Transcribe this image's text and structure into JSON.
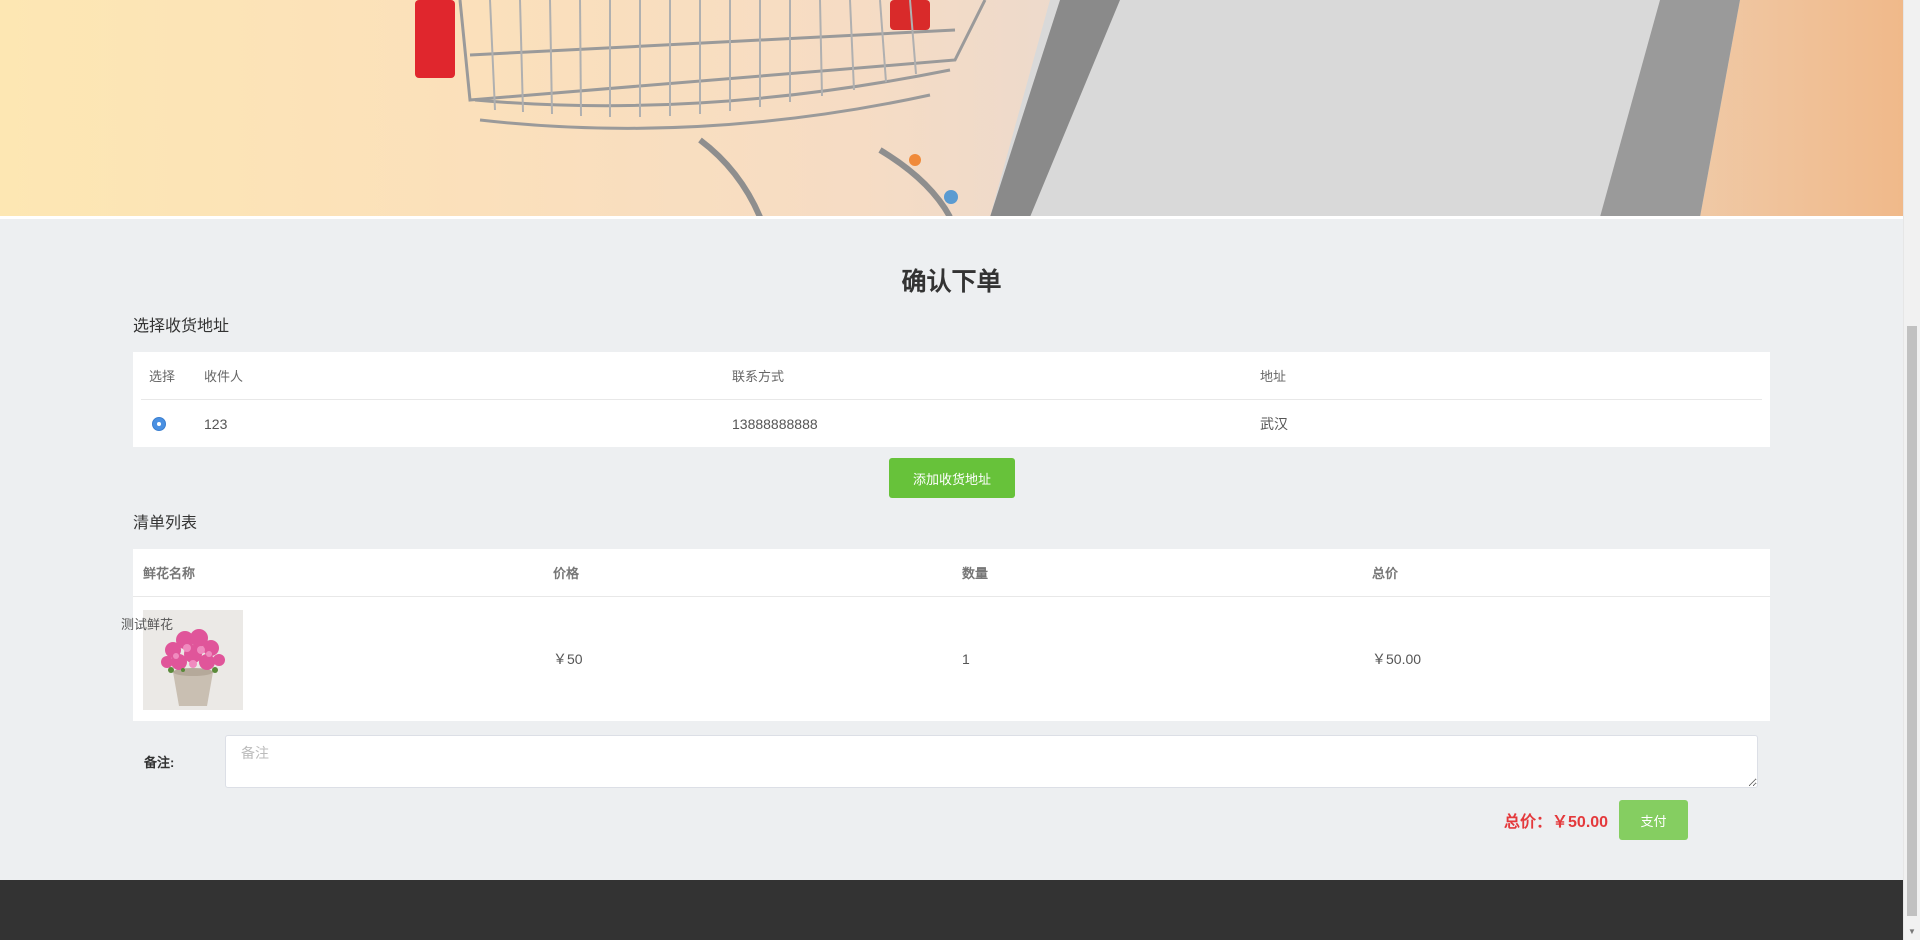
{
  "banner": {
    "dots": [
      true,
      false
    ]
  },
  "page": {
    "title": "确认下单"
  },
  "address": {
    "section_title": "选择收货地址",
    "headers": {
      "select": "选择",
      "recipient": "收件人",
      "contact": "联系方式",
      "address": "地址"
    },
    "rows": [
      {
        "selected": true,
        "recipient": "123",
        "contact": "13888888888",
        "address": "武汉"
      }
    ],
    "add_button": "添加收货地址"
  },
  "cart": {
    "section_title": "清单列表",
    "headers": {
      "name": "鲜花名称",
      "price": "价格",
      "quantity": "数量",
      "total": "总价"
    },
    "items": [
      {
        "name": "测试鲜花",
        "price": "￥50",
        "quantity": "1",
        "total": "￥50.00"
      }
    ]
  },
  "remark": {
    "label": "备注:",
    "placeholder": "备注",
    "value": ""
  },
  "summary": {
    "total_label": "总价：",
    "total_value": "￥50.00",
    "pay_button": "支付"
  },
  "colors": {
    "accent_green": "#67c23a",
    "pay_green": "#85ce61",
    "price_red": "#e4393c",
    "radio_blue": "#4a90e2"
  }
}
